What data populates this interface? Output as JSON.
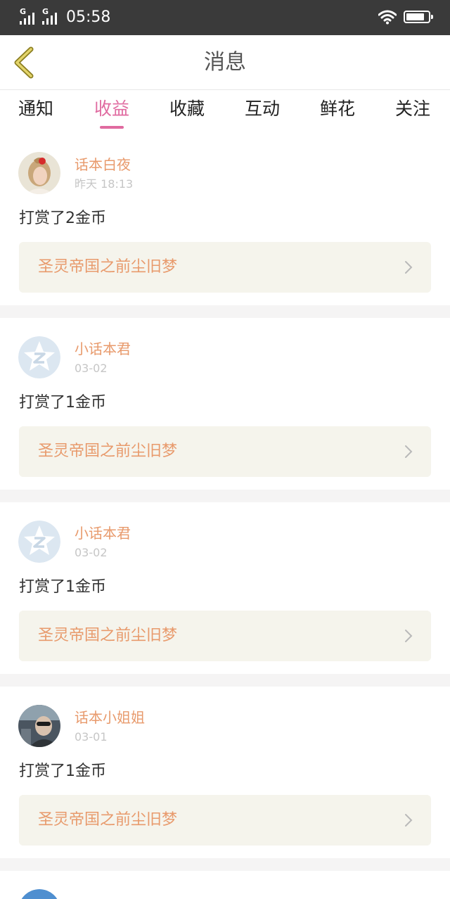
{
  "status_bar": {
    "signal_1_label": "G",
    "signal_2_label": "G",
    "time": "05:58",
    "wifi_icon": "wifi-icon",
    "battery_icon": "battery-icon",
    "battery_level": 0.9
  },
  "navbar": {
    "back_icon": "chevron-left-icon",
    "back_color": "#d4c55a",
    "title": "消息"
  },
  "tabs": {
    "active_index": 1,
    "active_color": "#e06ba0",
    "items": [
      {
        "label": "通知"
      },
      {
        "label": "收益"
      },
      {
        "label": "收藏"
      },
      {
        "label": "互动"
      },
      {
        "label": "鲜花"
      },
      {
        "label": "关注"
      }
    ]
  },
  "feed": {
    "name_color": "#e89a6c",
    "items": [
      {
        "avatar": "avatar-photo",
        "name": "话本白夜",
        "time": "昨天 18:13",
        "action": "打赏了2金币",
        "book": "圣灵帝国之前尘旧梦"
      },
      {
        "avatar": "default-avatar",
        "name": "小话本君",
        "time": "03-02",
        "action": "打赏了1金币",
        "book": "圣灵帝国之前尘旧梦"
      },
      {
        "avatar": "default-avatar",
        "name": "小话本君",
        "time": "03-02",
        "action": "打赏了1金币",
        "book": "圣灵帝国之前尘旧梦"
      },
      {
        "avatar": "avatar-photo",
        "name": "话本小姐姐",
        "time": "03-01",
        "action": "打赏了1金币",
        "book": "圣灵帝国之前尘旧梦"
      }
    ]
  }
}
